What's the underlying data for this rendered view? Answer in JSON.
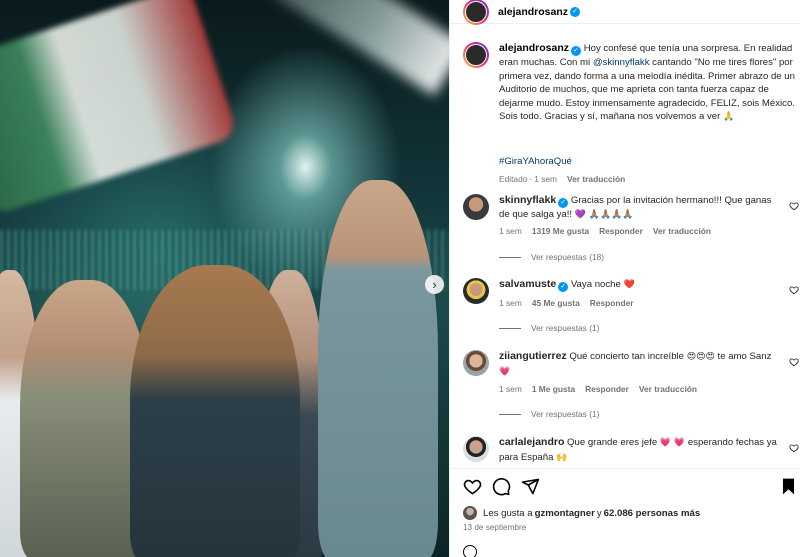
{
  "account": {
    "username": "alejandrosanz",
    "avatar_color": "#2a2a2a"
  },
  "caption": {
    "username": "alejandrosanz",
    "text_1": "Hoy confesé que tenía una sorpresa. En realidad eran muchas. Con mi ",
    "mention": "@skinnyflakk",
    "text_2": " cantando \"No me tires flores\" por primera vez, dando forma a una melodía inédita. Primer abrazo de un Auditorio de muchos, que me aprieta con tanta fuerza capaz de dejarme mudo. Estoy inmensamente agradecido, FELIZ, sois México. Sois todo. Gracias y sí, mañana nos volvemos a ver ",
    "emoji": "🙏",
    "hashtag": "#GiraYAhoraQué",
    "edited": "Editado",
    "dot": "·",
    "time": "1 sem",
    "translate": "Ver traducción"
  },
  "comments": [
    {
      "username": "skinnyflakk",
      "verified": true,
      "text": "Gracias por la invitación hermano!!! Que ganas de que salga ya!!",
      "emoji": "💜 🙏🏽🙏🏽🙏🏽🙏🏽",
      "time": "1 sem",
      "likes": "1319 Me gusta",
      "reply": "Responder",
      "translate": "Ver traducción",
      "view_replies": "Ver respuestas (18)"
    },
    {
      "username": "salvamuste",
      "verified": true,
      "text": "Vaya noche",
      "emoji": "❤️",
      "time": "1 sem",
      "likes": "45 Me gusta",
      "reply": "Responder",
      "view_replies": "Ver respuestas (1)"
    },
    {
      "username": "ziiangutierrez",
      "verified": false,
      "text": "Qué concierto tan increíble",
      "emoji": "😍😍😍",
      "text_2": "te amo Sanz",
      "emoji_2": "💗",
      "time": "1 sem",
      "likes": "1 Me gusta",
      "reply": "Responder",
      "translate": "Ver traducción",
      "view_replies": "Ver respuestas (1)"
    },
    {
      "username": "carlalejandro",
      "verified": false,
      "text": "Que grande eres jefe",
      "emoji": "💗 💗",
      "text_2": "esperando fechas ya para España",
      "emoji_2": "🙌"
    }
  ],
  "likes": {
    "prefix": "Les gusta a ",
    "user": "gzmontagner",
    "middle": " y ",
    "count": "62.086 personas más",
    "date": "13 de septiembre"
  },
  "media": {
    "next_arrow": "›"
  },
  "colors": {
    "verified": "#0095f6",
    "link": "#00376b",
    "secondary": "#737373",
    "like_heart": "#ed4956"
  }
}
